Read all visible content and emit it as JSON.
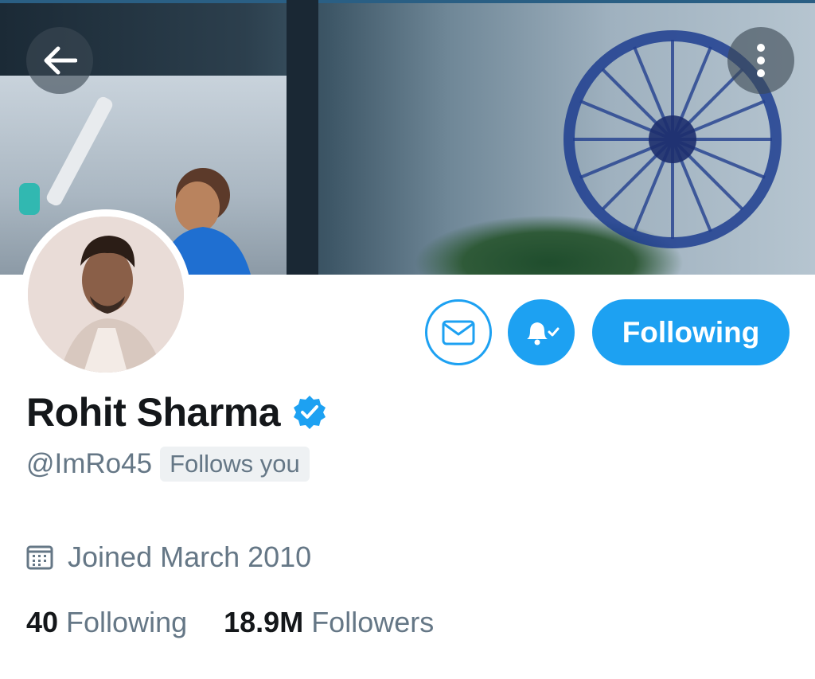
{
  "banner": {
    "image": "cricket-player-with-indian-flag-banner"
  },
  "header": {
    "back_icon": "arrow-left-icon",
    "more_icon": "vertical-dots-icon"
  },
  "profile": {
    "name": "Rohit Sharma",
    "verified": true,
    "handle": "@ImRo45",
    "follows_you_label": "Follows you",
    "joined": "Joined March 2010",
    "stats": {
      "following_count": "40",
      "following_label": "Following",
      "followers_count": "18.9M",
      "followers_label": "Followers"
    }
  },
  "actions": {
    "message_icon": "envelope-icon",
    "notifications_icon": "bell-check-icon",
    "follow_button_label": "Following"
  },
  "colors": {
    "accent": "#1da1f2",
    "text_primary": "#14171a",
    "text_secondary": "#657786"
  }
}
